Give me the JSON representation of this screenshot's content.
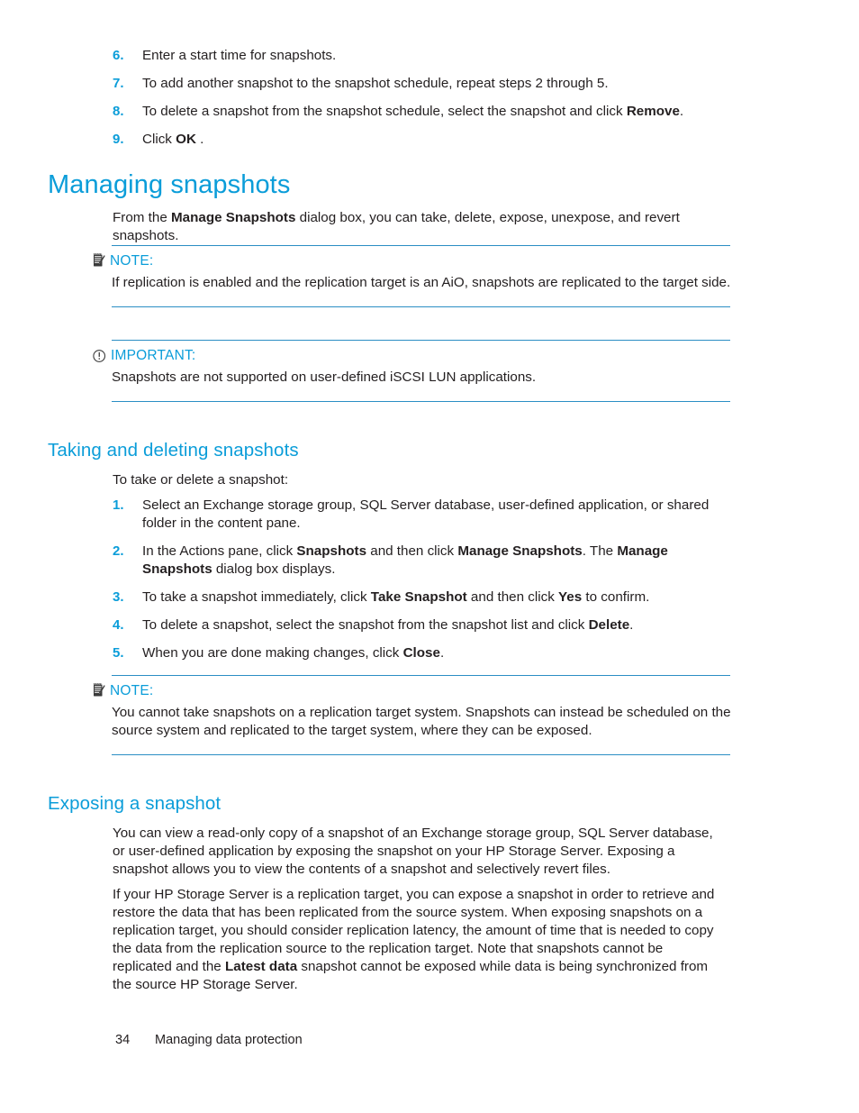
{
  "document": {
    "page_number": "34",
    "footer_title": "Managing data protection"
  },
  "colors": {
    "heading_blue": "#0b9dd9",
    "rule_blue": "#2b8ec4",
    "body_text": "#231f20"
  },
  "top_list": {
    "items": [
      {
        "num": "6.",
        "text_before": "Enter a start time for snapshots.",
        "bold": "",
        "text_after": ""
      },
      {
        "num": "7.",
        "text_before": "To add another snapshot to the snapshot schedule, repeat steps 2 through 5.",
        "bold": "",
        "text_after": ""
      },
      {
        "num": "8.",
        "text_before": "To delete a snapshot from the snapshot schedule, select the snapshot and click ",
        "bold": "Remove",
        "text_after": "."
      },
      {
        "num": "9.",
        "text_before": "Click ",
        "bold": "OK",
        "text_after": " ."
      }
    ]
  },
  "section_managing": {
    "title": "Managing snapshots",
    "intro_before": "From the ",
    "intro_bold": "Manage Snapshots",
    "intro_after": " dialog box, you can take, delete, expose, unexpose, and revert snapshots."
  },
  "note_1": {
    "icon": "note-icon",
    "label": "NOTE:",
    "body": "If replication is enabled and the replication target is an AiO, snapshots are replicated to the target side."
  },
  "important_1": {
    "icon": "important-icon",
    "label": "IMPORTANT:",
    "body": "Snapshots are not supported on user-defined iSCSI LUN applications."
  },
  "section_taking": {
    "title": "Taking and deleting snapshots",
    "intro": "To take or delete a snapshot:",
    "items": [
      {
        "num": "1.",
        "p1": "Select an Exchange storage group, SQL Server database, user-defined application, or shared folder in the content pane.",
        "b1": "",
        "p2": "",
        "b2": "",
        "p3": "",
        "b3": "",
        "p4": ""
      },
      {
        "num": "2.",
        "p1": "In the Actions pane, click ",
        "b1": "Snapshots",
        "p2": " and then click ",
        "b2": "Manage Snapshots",
        "p3": ". The ",
        "b3": "Manage Snapshots",
        "p4": " dialog box displays."
      },
      {
        "num": "3.",
        "p1": "To take a snapshot immediately, click ",
        "b1": "Take Snapshot",
        "p2": " and then click ",
        "b2": "Yes",
        "p3": " to confirm.",
        "b3": "",
        "p4": ""
      },
      {
        "num": "4.",
        "p1": "To delete a snapshot, select the snapshot from the snapshot list and click ",
        "b1": "Delete",
        "p2": ".",
        "b2": "",
        "p3": "",
        "b3": "",
        "p4": ""
      },
      {
        "num": "5.",
        "p1": "When you are done making changes, click ",
        "b1": "Close",
        "p2": ".",
        "b2": "",
        "p3": "",
        "b3": "",
        "p4": ""
      }
    ]
  },
  "note_2": {
    "icon": "note-icon",
    "label": "NOTE:",
    "body": "You cannot take snapshots on a replication target system. Snapshots can instead be scheduled on the source system and replicated to the target system, where they can be exposed."
  },
  "section_exposing": {
    "title": "Exposing a snapshot",
    "para_1": "You can view a read-only copy of a snapshot of an Exchange storage group, SQL Server database, or user-defined application by exposing the snapshot on your HP Storage Server. Exposing a snapshot allows you to view the contents of a snapshot and selectively revert files.",
    "para_2_before": "If your HP Storage Server is a replication target, you can expose a snapshot in order to retrieve and restore the data that has been replicated from the source system. When exposing snapshots on a replication target, you should consider replication latency, the amount of time that is needed to copy the data from the replication source to the replication target. Note that snapshots cannot be replicated and the ",
    "para_2_bold": "Latest data",
    "para_2_after": " snapshot cannot be exposed while data is being synchronized from the source HP Storage Server."
  }
}
